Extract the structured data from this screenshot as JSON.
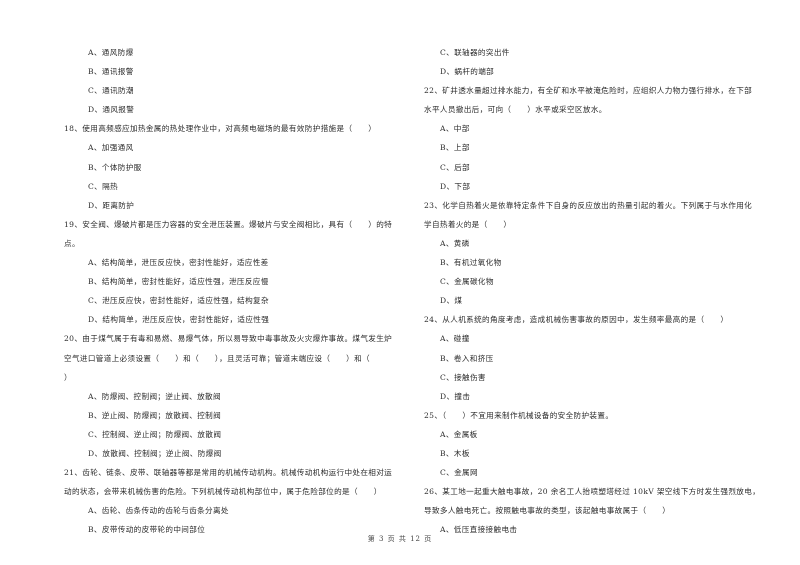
{
  "left_column": [
    {
      "type": "opt",
      "text": "A、通风防爆"
    },
    {
      "type": "opt",
      "text": "B、通讯报警"
    },
    {
      "type": "opt",
      "text": "C、通讯防潮"
    },
    {
      "type": "opt",
      "text": "D、通风报警"
    },
    {
      "type": "q",
      "text": "18、使用高频感应加热金属的热处理作业中，对高频电磁场的最有效防护措施是（　　）"
    },
    {
      "type": "opt",
      "text": "A、加强通风"
    },
    {
      "type": "opt",
      "text": "B、个体防护服"
    },
    {
      "type": "opt",
      "text": "C、隔热"
    },
    {
      "type": "opt",
      "text": "D、距离防护"
    },
    {
      "type": "q",
      "text": "19、安全阀、爆破片都是压力容器的安全泄压装置。爆破片与安全阀相比，具有（　　）的特"
    },
    {
      "type": "q",
      "text": "点。"
    },
    {
      "type": "opt",
      "text": "A、结构简单，泄压反应快，密封性能好，适应性差"
    },
    {
      "type": "opt",
      "text": "B、结构简单，密封性能好，适应性强，泄压反应慢"
    },
    {
      "type": "opt",
      "text": "C、泄压反应快，密封性能好，适应性强，结构复杂"
    },
    {
      "type": "opt",
      "text": "D、结构简单，泄压反应快，密封性能好，适应性强"
    },
    {
      "type": "q",
      "text": "20、由于煤气属于有毒和易燃、易爆气体，所以易导致中毒事故及火灾爆炸事故。煤气发生炉"
    },
    {
      "type": "q",
      "text": "空气进口管道上必须设置（　　）和（　　），且灵活可靠；管道末端应设（　　）和（"
    },
    {
      "type": "q",
      "text": "）"
    },
    {
      "type": "opt",
      "text": "A、防爆阀、控制阀；逆止阀、放散阀"
    },
    {
      "type": "opt",
      "text": "B、逆止阀、防爆阀；放散阀、控制阀"
    },
    {
      "type": "opt",
      "text": "C、控制阀、逆止阀；防爆阀、放散阀"
    },
    {
      "type": "opt",
      "text": "D、放散阀、控制阀；逆止阀、防爆阀"
    },
    {
      "type": "q",
      "text": "21、齿轮、链条、皮带、联轴器等都是常用的机械传动机构。机械传动机构运行中处在相对运"
    },
    {
      "type": "q",
      "text": "动的状态，会带来机械伤害的危险。下列机械传动机构部位中，属于危险部位的是（　　）"
    },
    {
      "type": "opt",
      "text": "A、齿轮、齿条传动的齿轮与齿条分离处"
    },
    {
      "type": "opt",
      "text": "B、皮带传动的皮带轮的中间部位"
    }
  ],
  "right_column": [
    {
      "type": "opt",
      "text": "C、联轴器的突出件"
    },
    {
      "type": "opt",
      "text": "D、蜗杆的端部"
    },
    {
      "type": "q",
      "text": "22、矿井透水量超过排水能力，有全矿和水平被淹危险时，应组织人力物力强行排水，在下部"
    },
    {
      "type": "q",
      "text": "水平人员撤出后，可向（　　）水平或采空区放水。"
    },
    {
      "type": "opt",
      "text": "A、中部"
    },
    {
      "type": "opt",
      "text": "B、上部"
    },
    {
      "type": "opt",
      "text": "C、后部"
    },
    {
      "type": "opt",
      "text": "D、下部"
    },
    {
      "type": "q",
      "text": "23、化学自热着火是依靠特定条件下自身的反应放出的热量引起的着火。下列属于与水作用化"
    },
    {
      "type": "q",
      "text": "学自热着火的是（　　）"
    },
    {
      "type": "opt",
      "text": "A、黄磷"
    },
    {
      "type": "opt",
      "text": "B、有机过氧化物"
    },
    {
      "type": "opt",
      "text": "C、金属碳化物"
    },
    {
      "type": "opt",
      "text": "D、煤"
    },
    {
      "type": "q",
      "text": "24、从人机系统的角度考虑，造成机械伤害事故的原因中，发生频率最高的是（　　）"
    },
    {
      "type": "opt",
      "text": "A、碰撞"
    },
    {
      "type": "opt",
      "text": "B、卷入和挤压"
    },
    {
      "type": "opt",
      "text": "C、接触伤害"
    },
    {
      "type": "opt",
      "text": "D、撞击"
    },
    {
      "type": "q",
      "text": "25、（　　）不宜用来制作机械设备的安全防护装置。"
    },
    {
      "type": "opt",
      "text": "A、金属板"
    },
    {
      "type": "opt",
      "text": "B、木板"
    },
    {
      "type": "opt",
      "text": "C、金属网"
    },
    {
      "type": "q",
      "text": "26、某工地一起重大触电事故，20 余名工人抬喷塑塔经过 10kV 架空线下方时发生强烈放电，"
    },
    {
      "type": "q",
      "text": "导致多人触电死亡。按照触电事故的类型，该起触电事故属于（　　）"
    },
    {
      "type": "opt",
      "text": "A、低压直接接触电击"
    }
  ],
  "footer": {
    "page_label": "第 3 页 共 12 页"
  }
}
